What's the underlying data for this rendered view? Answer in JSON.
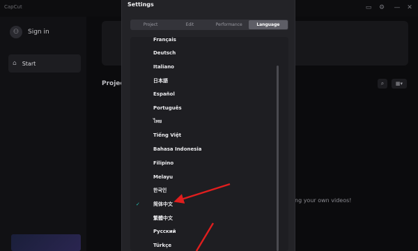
{
  "app": {
    "logo_text": "CapCut"
  },
  "titlebar": {
    "icons": [
      {
        "name": "feedback-icon",
        "glyph": "▭"
      },
      {
        "name": "settings-gear-icon",
        "glyph": "⚙"
      },
      {
        "name": "minimize-icon",
        "glyph": "—"
      },
      {
        "name": "close-icon",
        "glyph": "✕"
      }
    ]
  },
  "sidebar": {
    "sign_in_label": "Sign in",
    "start_label": "Start"
  },
  "main": {
    "projects_label": "Project",
    "empty_text": "ng your own videos!"
  },
  "settings": {
    "title": "Settings",
    "tabs": [
      "Project",
      "Edit",
      "Performance",
      "Language"
    ],
    "active_tab": "Language",
    "languages": [
      "Français",
      "Deutsch",
      "Italiano",
      "日本語",
      "Español",
      "Português",
      "ไทย",
      "Tiếng Việt",
      "Bahasa Indonesia",
      "Filipino",
      "Melayu",
      "한국인",
      "简体中文",
      "繁體中文",
      "Русский",
      "Türkçe"
    ],
    "selected_language": "简体中文"
  },
  "colors": {
    "accent": "#27c2b4",
    "annotation_arrow": "#e01e1e"
  }
}
